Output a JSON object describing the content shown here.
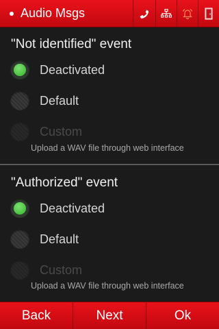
{
  "header": {
    "title": "Audio Msgs",
    "icons": [
      "phone-icon",
      "network-icon",
      "bell-icon",
      "door-icon"
    ]
  },
  "sections": [
    {
      "title": "\"Not identified\" event",
      "options": [
        {
          "label": "Deactivated",
          "selected": true,
          "enabled": true
        },
        {
          "label": "Default",
          "selected": false,
          "enabled": true
        },
        {
          "label": "Custom",
          "selected": false,
          "enabled": false
        }
      ],
      "hint": "Upload a WAV file through web interface"
    },
    {
      "title": "\"Authorized\" event",
      "options": [
        {
          "label": "Deactivated",
          "selected": true,
          "enabled": true
        },
        {
          "label": "Default",
          "selected": false,
          "enabled": true
        },
        {
          "label": "Custom",
          "selected": false,
          "enabled": false
        }
      ],
      "hint": "Upload a WAV file through web interface"
    }
  ],
  "footer": {
    "back_label": "Back",
    "next_label": "Next",
    "ok_label": "Ok"
  },
  "colors": {
    "accent": "#d40d14",
    "background": "#1b1b1b",
    "selected": "#44c23a"
  }
}
